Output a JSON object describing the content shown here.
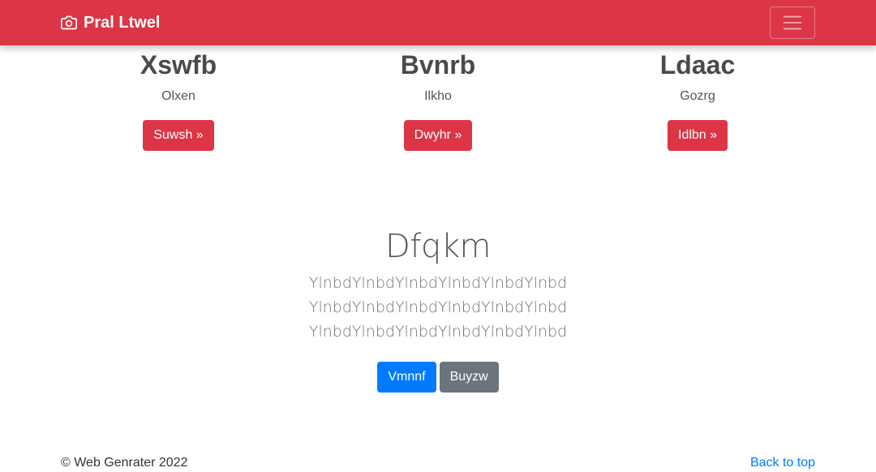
{
  "navbar": {
    "brand": "Pral Ltwel",
    "brand_icon": "camera-icon",
    "toggler_icon": "hamburger-icon",
    "color": "#dc3545"
  },
  "features": [
    {
      "title": "Xswfb",
      "text": "Olxen",
      "button": "Suwsh »"
    },
    {
      "title": "Bvnrb",
      "text": "Ilkho",
      "button": "Dwyhr »"
    },
    {
      "title": "Ldaac",
      "text": "Gozrg",
      "button": "Idlbn »"
    }
  ],
  "hero": {
    "title": "Dfqkm",
    "lead": "YlnbdYlnbdYlnbdYlnbdYlnbdYlnbd YlnbdYlnbdYlnbdYlnbdYlnbdYlnbd YlnbdYlnbdYlnbdYlnbdYlnbdYlnbd",
    "primary_button": "Vmnnf",
    "secondary_button": "Buyzw"
  },
  "footer": {
    "copyright": "© Web Genrater 2022",
    "back_to_top": "Back to top"
  }
}
